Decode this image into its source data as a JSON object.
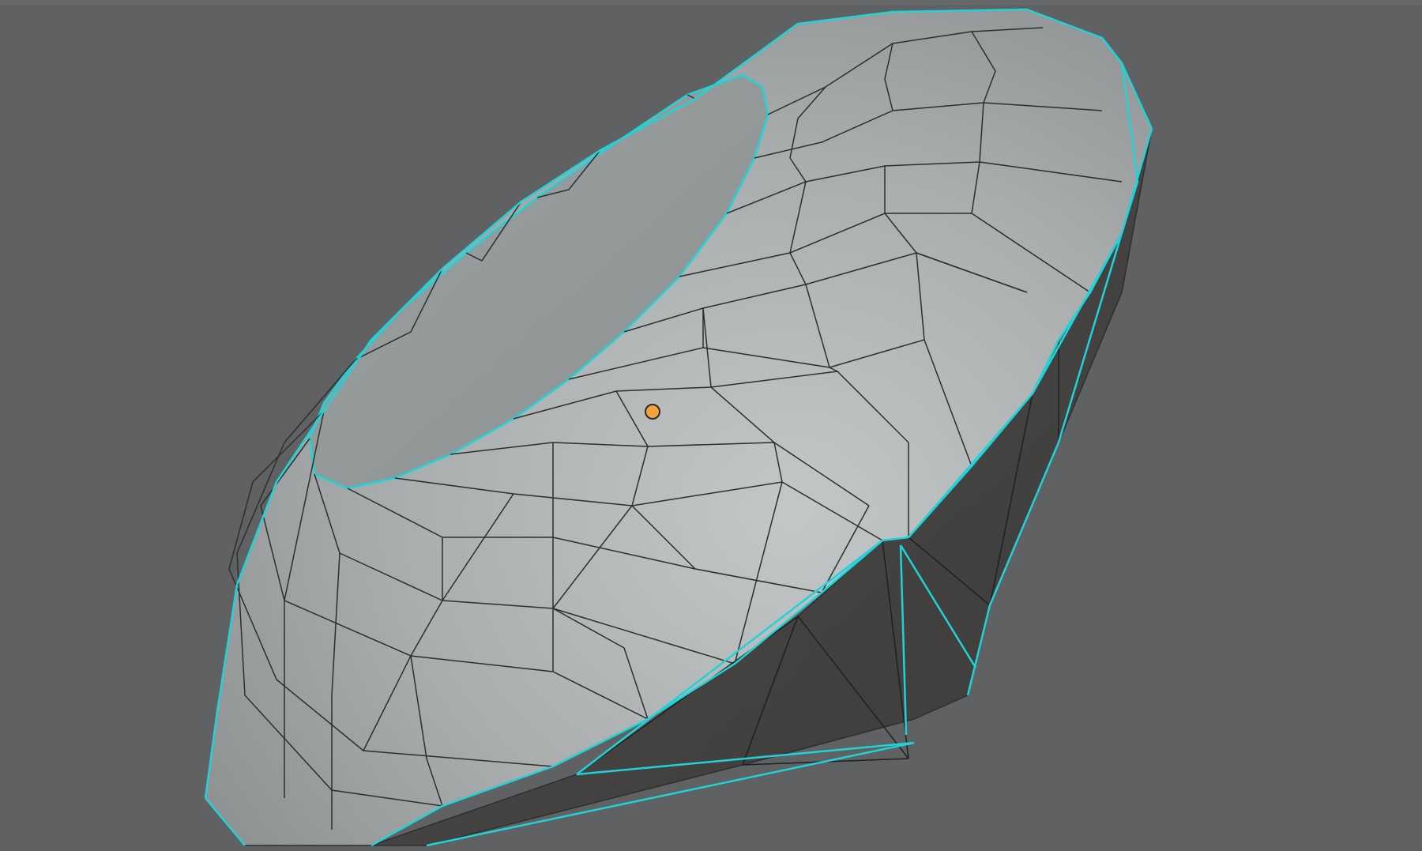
{
  "viewport": {
    "background_color": "#5f6162",
    "mesh": {
      "object_name": "",
      "face_light_color": "#a4a8a8",
      "face_shadow_color": "#444342",
      "wire_color": "#2c2f30",
      "selected_edge_color": "#1fd3d8",
      "origin_dot_color": "#f2a33a",
      "icon": "gem-mesh-icon"
    }
  }
}
